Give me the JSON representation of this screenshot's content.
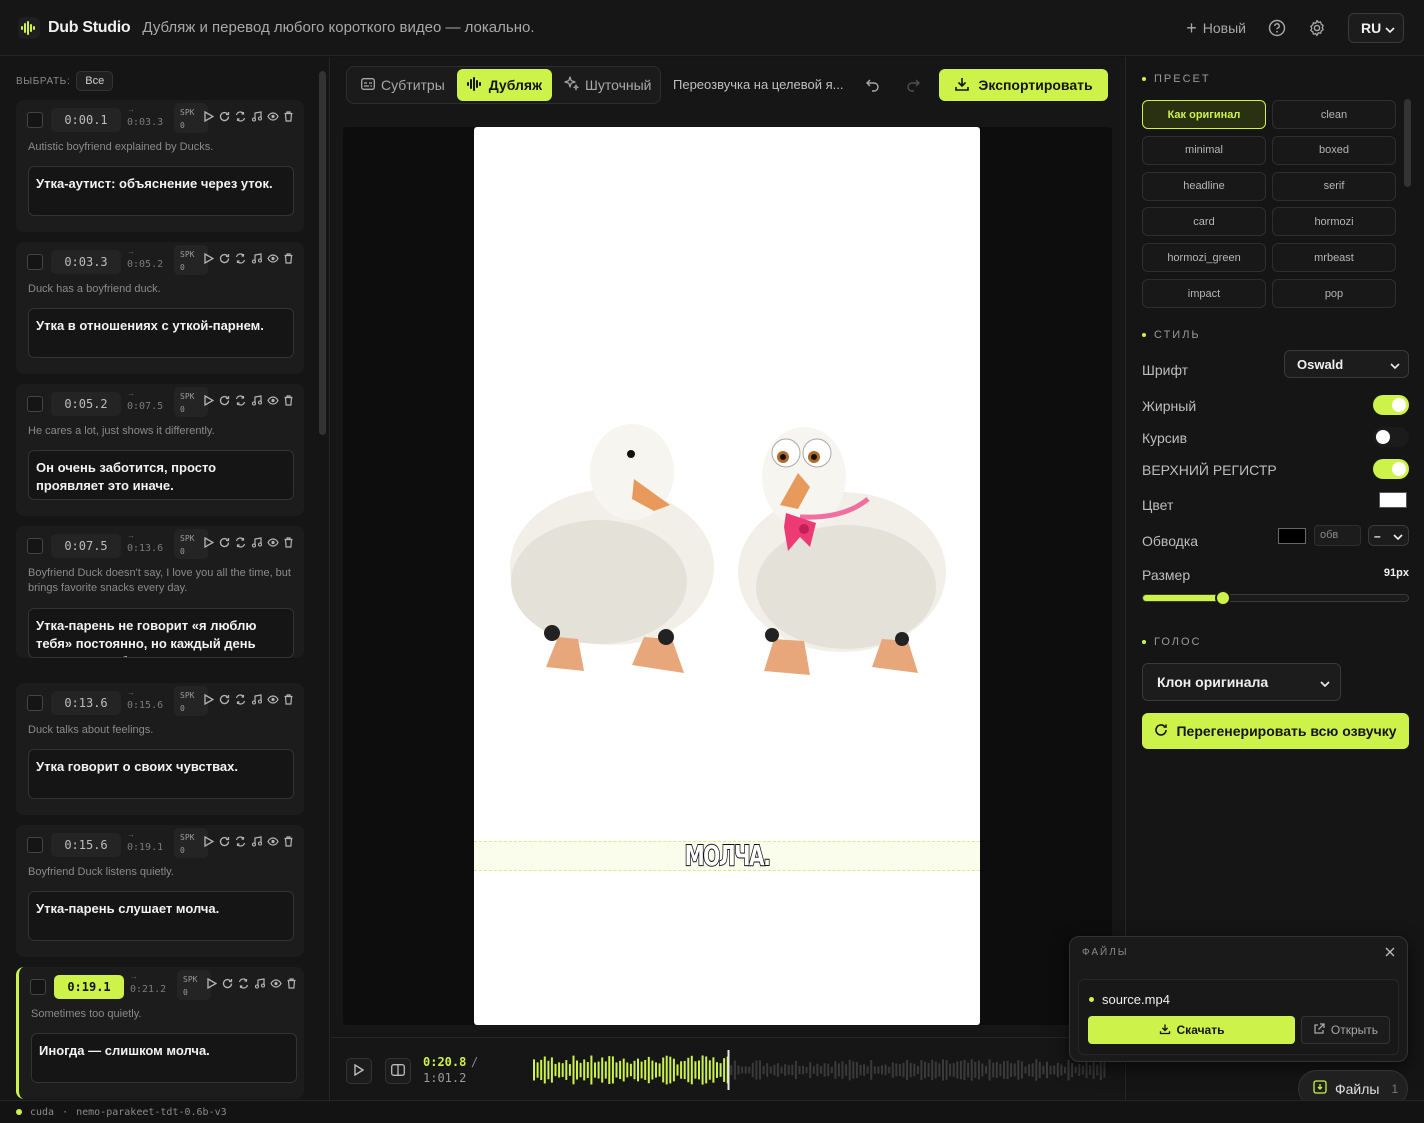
{
  "app": {
    "name": "Dub Studio",
    "tagline": "Дубляж и перевод любого короткого видео — локально.",
    "new_label": "Новый",
    "lang": "RU"
  },
  "colors": {
    "accent": "#cdf34a",
    "bg": "#141414",
    "panel": "#1c1c1c"
  },
  "left": {
    "select_label": "ВЫБРАТЬ:",
    "select_all": "Все",
    "segments": [
      {
        "start": "0:00.1",
        "end": "0:03.3",
        "speaker": "SPK\n0",
        "original": "Autistic boyfriend explained by Ducks.",
        "translation": "Утка-аутист: объяснение через уток.",
        "active": false
      },
      {
        "start": "0:03.3",
        "end": "0:05.2",
        "speaker": "SPK\n0",
        "original": "Duck has a boyfriend duck.",
        "translation": "Утка в отношениях с уткой-парнем.",
        "active": false
      },
      {
        "start": "0:05.2",
        "end": "0:07.5",
        "speaker": "SPK\n0",
        "original": "He cares a lot, just shows it differently.",
        "translation": "Он очень заботится, просто проявляет это иначе.",
        "active": false
      },
      {
        "start": "0:07.5",
        "end": "0:13.6",
        "speaker": "SPK\n0",
        "original": "Boyfriend Duck doesn't say, I love you all the time, but brings favorite snacks every day.",
        "translation": "Утка-парень не говорит «я люблю тебя» постоянно, но каждый день приносит любимые закуски.",
        "active": false
      },
      {
        "start": "0:13.6",
        "end": "0:15.6",
        "speaker": "SPK\n0",
        "original": "Duck talks about feelings.",
        "translation": "Утка говорит о своих чувствах.",
        "active": false
      },
      {
        "start": "0:15.6",
        "end": "0:19.1",
        "speaker": "SPK\n0",
        "original": "Boyfriend Duck listens quietly.",
        "translation": "Утка-парень слушает молча.",
        "active": false
      },
      {
        "start": "0:19.1",
        "end": "0:21.2",
        "speaker": "SPK\n0",
        "original": "Sometimes too quietly.",
        "translation": "Иногда — слишком молча.",
        "active": true
      }
    ]
  },
  "center": {
    "tabs": [
      "Субтитры",
      "Дубляж",
      "Шуточный"
    ],
    "active_tab": "Дубляж",
    "mode_desc": "Переозвучка на целевой я...",
    "export_label": "Экспортировать",
    "subtitle_text": "МОЛЧА.",
    "time_current": "0:20.8",
    "time_sep": "/",
    "time_total": "1:01.2",
    "playback_fraction": 0.34
  },
  "right": {
    "preset_title": "ПРЕСЕТ",
    "presets": [
      "Как оригинал",
      "clean",
      "minimal",
      "boxed",
      "headline",
      "serif",
      "card",
      "hormozi",
      "hormozi_green",
      "mrbeast",
      "impact",
      "pop"
    ],
    "active_preset": "Как оригинал",
    "style_title": "СТИЛЬ",
    "font_label": "Шрифт",
    "font_value": "Oswald",
    "bold_label": "Жирный",
    "bold_on": true,
    "italic_label": "Курсив",
    "italic_on": false,
    "upper_label": "ВЕРХНИЙ РЕГИСТР",
    "upper_on": true,
    "color_label": "Цвет",
    "text_color": "#ffffff",
    "stroke_label": "Обводка",
    "stroke_color": "#000000",
    "stroke_side": "обв",
    "stroke_width": "–",
    "size_label": "Размер",
    "size_value": "91px",
    "size_fraction": 0.3,
    "voice_title": "ГОЛОС",
    "voice_value": "Клон оригинала",
    "regen_label": "Перегенерировать всю озвучку"
  },
  "files": {
    "title": "ФАЙЛЫ",
    "file_name": "source.mp4",
    "download_label": "Скачать",
    "open_label": "Открыть",
    "pill_label": "Файлы",
    "pill_count": "1"
  },
  "status": {
    "device": "cuda",
    "sep": "·",
    "model": "nemo-parakeet-tdt-0.6b-v3"
  }
}
